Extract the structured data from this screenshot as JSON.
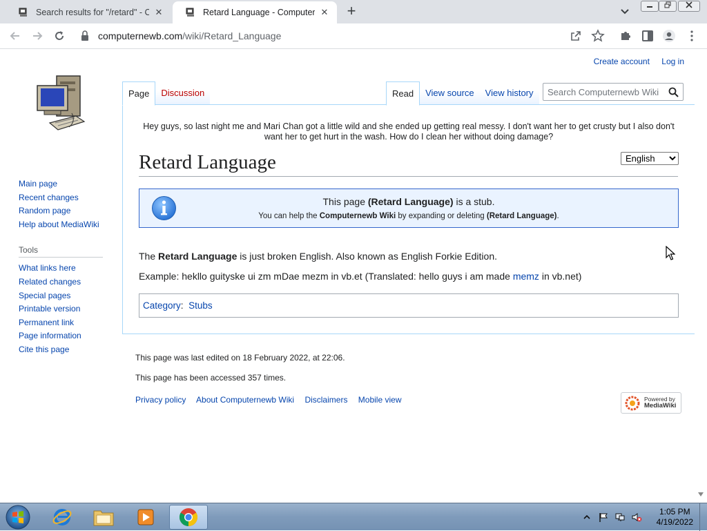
{
  "browser": {
    "tabs": [
      {
        "title": "Search results for \"/retard\" - Com",
        "active": false
      },
      {
        "title": "Retard Language - Computernew",
        "active": true
      }
    ],
    "close_glyph": "✕",
    "newtab_glyph": "+",
    "url": {
      "host": "computernewb.com",
      "path": "/wiki/Retard_Language"
    }
  },
  "wiki": {
    "sidebar": {
      "nav": [
        "Main page",
        "Recent changes",
        "Random page",
        "Help about MediaWiki"
      ],
      "tools_title": "Tools",
      "tools": [
        "What links here",
        "Related changes",
        "Special pages",
        "Printable version",
        "Permanent link",
        "Page information",
        "Cite this page"
      ]
    },
    "personal": {
      "create_account": "Create account",
      "login": "Log in"
    },
    "tabs": {
      "page": "Page",
      "discussion": "Discussion",
      "read": "Read",
      "view_source": "View source",
      "view_history": "View history"
    },
    "search_placeholder": "Search Computernewb Wiki",
    "sitenotice": "Hey guys, so last night me and Mari Chan got a little wild and she ended up getting real messy. I don't want her to get crusty but I also don't want her to get hurt in the wash. How do I clean her without doing damage?",
    "title": "Retard Language",
    "language_select": "English",
    "stub": {
      "l1_pre": "This page ",
      "l1_bold": "(Retard Language)",
      "l1_post": " is a stub.",
      "l2_pre": "You can help the ",
      "l2_bold": "Computernewb Wiki",
      "l2_mid": " by expanding or deleting ",
      "l2_bold2": "(Retard Language)",
      "l2_post": "."
    },
    "body": {
      "p1_pre": "The ",
      "p1_bold": "Retard Language",
      "p1_post": " is just broken English. Also known as English Forkie Edition.",
      "p2_pre": "Example: hekllo guityske ui zm mDae mezm in vb.et (Translated: hello guys i am made ",
      "p2_link": "memz",
      "p2_post": " in vb.net)"
    },
    "category": {
      "label": "Category",
      "sep": ":",
      "value": "Stubs"
    },
    "footer": {
      "last_edited": "This page was last edited on 18 February 2022, at 22:06.",
      "accessed": "This page has been accessed 357 times.",
      "links": [
        "Privacy policy",
        "About Computernewb Wiki",
        "Disclaimers",
        "Mobile view"
      ],
      "powered_by_1": "Powered by",
      "powered_by_2": "MediaWiki"
    }
  },
  "taskbar": {
    "time": "1:05 PM",
    "date": "4/19/2022"
  },
  "colors": {
    "link": "#0645ad",
    "redlink": "#ba0000",
    "tab_border": "#a7d7f9",
    "stub_bg": "#eaf3ff"
  }
}
